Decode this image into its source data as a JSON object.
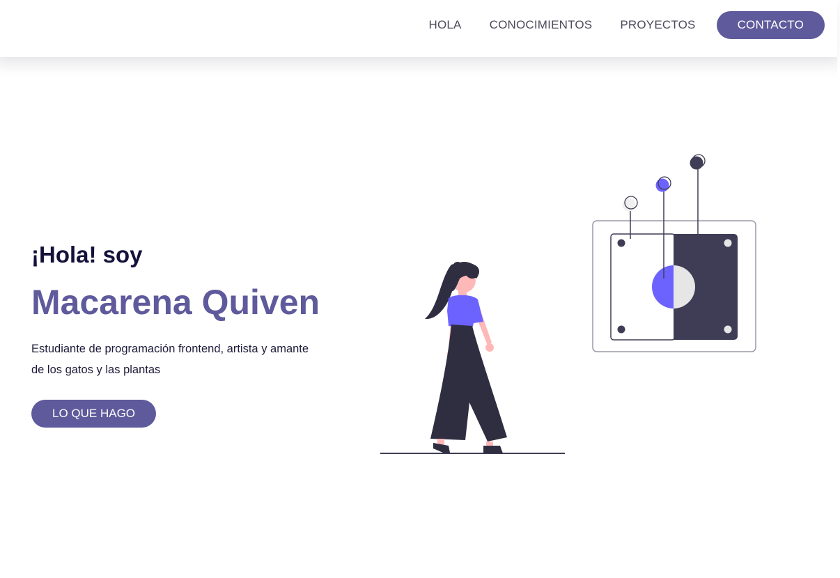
{
  "nav": {
    "items": [
      {
        "label": "HOLA"
      },
      {
        "label": "CONOCIMIENTOS"
      },
      {
        "label": "PROYECTOS"
      }
    ],
    "cta_label": "CONTACTO"
  },
  "hero": {
    "greeting": "¡Hola! soy",
    "name": "Macarena Quiven",
    "description": "Estudiante de programación frontend, artista y amante de los gatos y las plantas",
    "button_label": "LO QUE HAGO"
  },
  "illustration": {
    "icon": "woman-looking-at-switch-board-illustration"
  },
  "colors": {
    "accent": "#5e5a9c",
    "dark_text": "#14123a",
    "illustration_purple": "#6c63ff",
    "illustration_dark": "#3f3d56"
  }
}
